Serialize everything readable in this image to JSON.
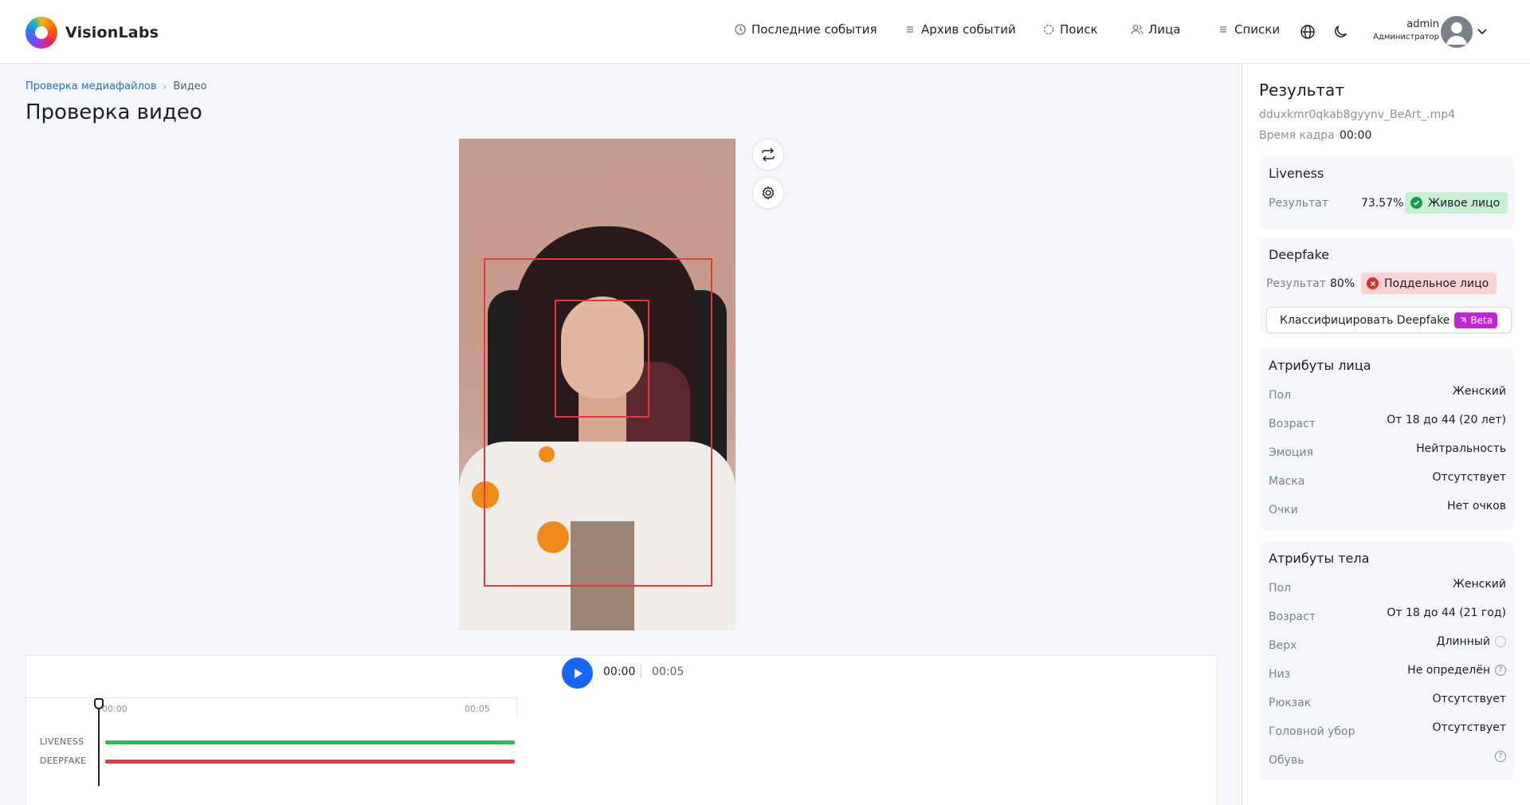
{
  "header": {
    "brand": "VisionLabs",
    "nav": [
      {
        "icon": "clock-icon",
        "label": "Последние события"
      },
      {
        "icon": "list-icon",
        "label": "Архив событий"
      },
      {
        "icon": "search-circle-icon",
        "label": "Поиск"
      },
      {
        "icon": "users-icon",
        "label": "Лица"
      },
      {
        "icon": "list-icon",
        "label": "Списки"
      }
    ],
    "user": {
      "name": "admin",
      "role": "Администратор"
    }
  },
  "main": {
    "breadcrumb": {
      "parent": "Проверка медиафайлов",
      "current": "Видео"
    },
    "title": "Проверка видео"
  },
  "player": {
    "current_time": "00:00",
    "duration": "00:05",
    "timeline": {
      "tick_start": "00:00",
      "tick_end": "00:05",
      "playhead_fraction": 0.0,
      "tracks": [
        {
          "label": "LIVENESS",
          "color": "#2cbf4f"
        },
        {
          "label": "DEEPFAKE",
          "color": "#ea3b3b"
        }
      ]
    }
  },
  "result": {
    "title": "Результат",
    "file": "dduxkmr0qkab8gyynv_BeArt_.mp4",
    "frame_time_label": "Время кадра",
    "frame_time": "00:00",
    "liveness": {
      "title": "Liveness",
      "label": "Результат",
      "score": "73.57%",
      "verdict": "Живое лицо"
    },
    "deepfake": {
      "title": "Deepfake",
      "label": "Результат",
      "score": "80%",
      "verdict": "Поддельное лицо",
      "classify_label": "Классифицировать Deepfake",
      "beta": "Beta"
    },
    "face_attributes": {
      "title": "Атрибуты лица",
      "rows": [
        {
          "label": "Пол",
          "value": "Женский"
        },
        {
          "label": "Возраст",
          "value": "От 18 до 44 (20 лет)"
        },
        {
          "label": "Эмоция",
          "value": "Нейтральность"
        },
        {
          "label": "Маска",
          "value": "Отсутствует"
        },
        {
          "label": "Очки",
          "value": "Нет очков"
        }
      ]
    },
    "body_attributes": {
      "title": "Атрибуты тела",
      "rows": [
        {
          "label": "Пол",
          "value": "Женский"
        },
        {
          "label": "Возраст",
          "value": "От 18 до 44 (21 год)"
        },
        {
          "label": "Верх",
          "value": "Длинный"
        },
        {
          "label": "Низ",
          "value": "Не определён"
        },
        {
          "label": "Рюкзак",
          "value": "Отсутствует"
        },
        {
          "label": "Головной убор",
          "value": "Отсутствует"
        },
        {
          "label": "Обувь",
          "value": ""
        }
      ]
    }
  },
  "colors": {
    "accent": "#1565ff",
    "live": "#2cbf4f",
    "fake": "#ea3b3b",
    "bbox": "#e53935"
  }
}
